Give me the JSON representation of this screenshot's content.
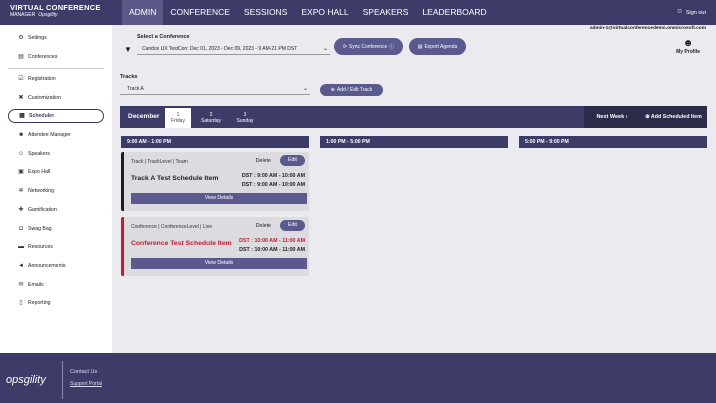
{
  "brand": {
    "line1": "VIRTUAL CONFERENCE",
    "line2": "MANAGER",
    "by": "Opsgility"
  },
  "nav": [
    {
      "label": "ADMIN",
      "active": true
    },
    {
      "label": "CONFERENCE"
    },
    {
      "label": "SESSIONS"
    },
    {
      "label": "EXPO HALL"
    },
    {
      "label": "SPEAKERS"
    },
    {
      "label": "LEADERBOARD"
    }
  ],
  "user": {
    "signout": "Sign out",
    "email": "admin-1@virtualconferencedemo.onmicrosoft.com",
    "profile": "My Profile"
  },
  "sidebar": [
    {
      "label": "Settings",
      "icon": "gear-icon"
    },
    {
      "label": "Conferences",
      "icon": "document-icon"
    },
    {
      "label": "Registration",
      "icon": "checkbox-icon"
    },
    {
      "label": "Customization",
      "icon": "tools-icon"
    },
    {
      "label": "Scheduler",
      "icon": "calendar-icon",
      "active": true
    },
    {
      "label": "Attendee Manager",
      "icon": "users-icon"
    },
    {
      "label": "Speakers",
      "icon": "speakers-icon"
    },
    {
      "label": "Expo Hall",
      "icon": "hall-icon"
    },
    {
      "label": "Networking",
      "icon": "network-icon"
    },
    {
      "label": "Gamification",
      "icon": "gamepad-icon"
    },
    {
      "label": "Swag Bag",
      "icon": "bag-icon"
    },
    {
      "label": "Resources",
      "icon": "folder-icon"
    },
    {
      "label": "Announcements",
      "icon": "megaphone-icon"
    },
    {
      "label": "Emails",
      "icon": "envelope-icon"
    },
    {
      "label": "Reporting",
      "icon": "report-icon"
    }
  ],
  "conference": {
    "label": "Select a Conference",
    "value": "Candox UX TestCon: Dec 01, 2023 - Dec 09, 2023 - 9 AM-21 PM DST",
    "sync": "Sync Conference",
    "export": "Export Agenda"
  },
  "tracks": {
    "label": "Tracks",
    "value": "Track A",
    "add": "Add / Edit Track"
  },
  "calendar": {
    "month": "December",
    "days": [
      {
        "num": "1",
        "name": "Friday",
        "active": true
      },
      {
        "num": "2",
        "name": "Saturday"
      },
      {
        "num": "3",
        "name": "Sunday"
      }
    ],
    "next": "Next Week",
    "add": "Add Scheduled Item"
  },
  "slots": [
    "9:00 AM - 1:00 PM",
    "1:00 PM - 5:00 PM",
    "5:00 PM - 9:00 PM"
  ],
  "cards": [
    {
      "meta": "Track | TrackLevel | Team",
      "delete": "Delete",
      "edit": "Edit",
      "title": "Track A Test Schedule Item",
      "dst1": "DST : 9:00 AM - 10:00 AM",
      "dst2": "DST : 9:00 AM - 10:00 AM",
      "view": "View Details"
    },
    {
      "meta": "Conference | ConferenceLevel | Live",
      "delete": "Delete",
      "edit": "Edit",
      "title": "Conference Test Schedule Item",
      "dst1": "DST : 10:00 AM - 11:00 AM",
      "dst2": "DST : 10:00 AM - 11:00 AM",
      "view": "View Details"
    }
  ],
  "footer": {
    "logo": "opsgility",
    "contact": "Contact Us",
    "support": "Support Portal"
  },
  "colors": {
    "header": "#3d3c68",
    "accent": "#5b5a8e",
    "conference": "#c41b2f"
  }
}
